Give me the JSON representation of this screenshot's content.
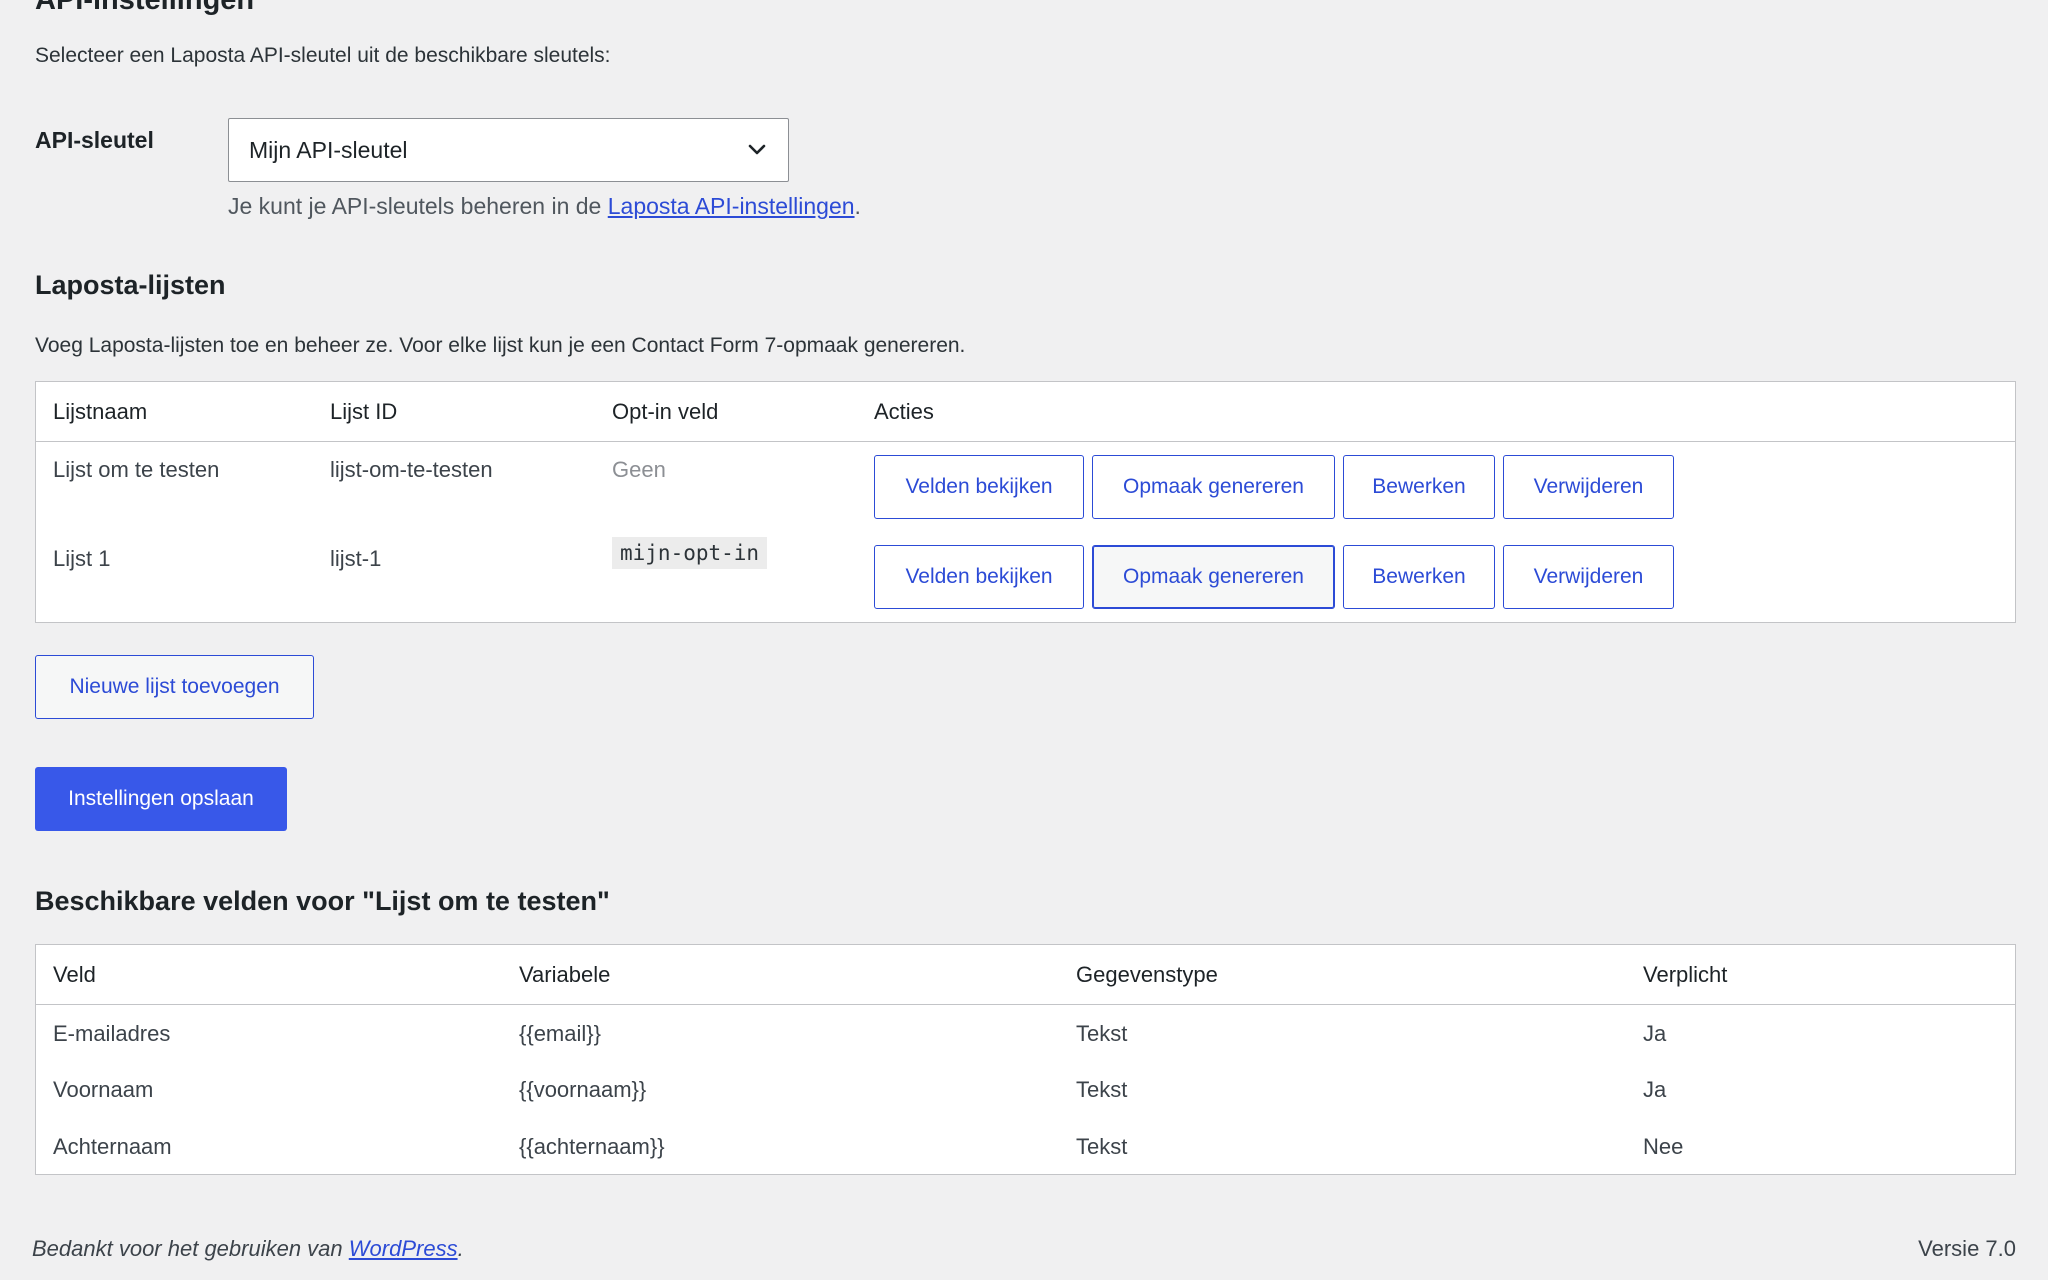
{
  "api": {
    "heading": "API-instellingen",
    "description": "Selecteer een Laposta API-sleutel uit de beschikbare sleutels:",
    "key_label": "API-sleutel",
    "key_selected": "Mijn API-sleutel",
    "help_prefix": "Je kunt je API-sleutels beheren in de ",
    "help_link": "Laposta API-instellingen",
    "help_suffix": "."
  },
  "lists": {
    "heading": "Laposta-lijsten",
    "description": "Voeg Laposta-lijsten toe en beheer ze. Voor elke lijst kun je een Contact Form 7-opmaak genereren.",
    "columns": [
      "Lijstnaam",
      "Lijst ID",
      "Opt-in veld",
      "Acties"
    ],
    "rows": [
      {
        "name": "Lijst om te testen",
        "id": "lijst-om-te-testen",
        "optin": "Geen"
      },
      {
        "name": "Lijst 1",
        "id": "lijst-1",
        "optin": "mijn-opt-in"
      }
    ],
    "actions": {
      "view": "Velden bekijken",
      "generate": "Opmaak genereren",
      "edit": "Bewerken",
      "delete": "Verwijderen"
    },
    "add_button": "Nieuwe lijst toevoegen",
    "save_button": "Instellingen opslaan"
  },
  "fields": {
    "heading": "Beschikbare velden voor \"Lijst om te testen\"",
    "columns": [
      "Veld",
      "Variabele",
      "Gegevenstype",
      "Verplicht"
    ],
    "rows": [
      {
        "field": "E-mailadres",
        "variable": "{{email}}",
        "type": "Tekst",
        "required": "Ja"
      },
      {
        "field": "Voornaam",
        "variable": "{{voornaam}}",
        "type": "Tekst",
        "required": "Ja"
      },
      {
        "field": "Achternaam",
        "variable": "{{achternaam}}",
        "type": "Tekst",
        "required": "Nee"
      }
    ]
  },
  "footer": {
    "thanks_prefix": "Bedankt voor het gebruiken van ",
    "thanks_link": "WordPress",
    "thanks_suffix": ".",
    "version": "Versie 7.0"
  },
  "colors": {
    "accent": "#3858e9",
    "link": "#2c4bd6",
    "background": "#f0f0f1"
  }
}
